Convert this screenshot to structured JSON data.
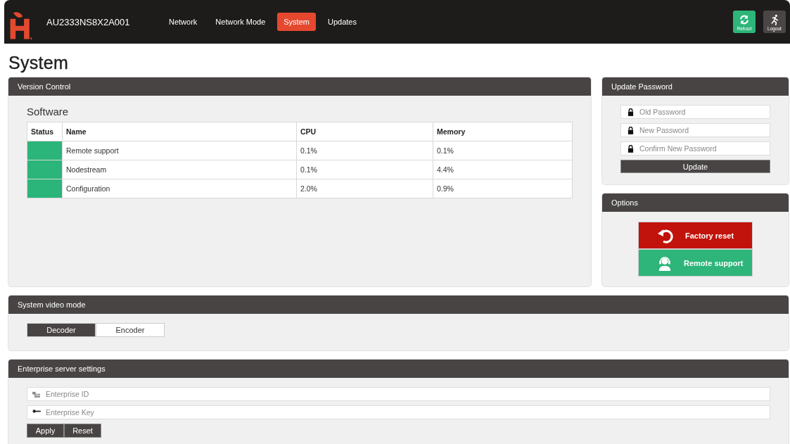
{
  "header": {
    "device_name": "AU2333NS8X2A001",
    "nav": [
      {
        "label": "Network",
        "selected": false
      },
      {
        "label": "Network Mode",
        "selected": false
      },
      {
        "label": "System",
        "selected": true
      },
      {
        "label": "Updates",
        "selected": false
      }
    ],
    "actions": [
      {
        "label": "Reboot",
        "kind": "reboot"
      },
      {
        "label": "Logout",
        "kind": "logout"
      }
    ]
  },
  "page_title": "System",
  "version_control": {
    "title": "Version Control",
    "heading": "Software",
    "columns": [
      "Status",
      "Name",
      "CPU",
      "Memory"
    ],
    "rows": [
      {
        "color": "#2bb57a",
        "name": "Remote support",
        "cpu": "0.1%",
        "memory": "0.1%"
      },
      {
        "color": "#2bb57a",
        "name": "Nodestream",
        "cpu": "0.1%",
        "memory": "4.4%"
      },
      {
        "color": "#2bb57a",
        "name": "Configuration",
        "cpu": "2.0%",
        "memory": "0.9%"
      }
    ]
  },
  "update_password": {
    "title": "Update Password",
    "fields": [
      {
        "placeholder": "Old Password"
      },
      {
        "placeholder": "New Password"
      },
      {
        "placeholder": "Confirm New Password"
      }
    ],
    "button": "Update"
  },
  "options": {
    "title": "Options",
    "buttons": [
      {
        "label": "Factory reset",
        "kind": "reset"
      },
      {
        "label": "Remote support",
        "kind": "support"
      }
    ]
  },
  "video_mode": {
    "title": "System video mode",
    "modes": [
      {
        "label": "Decoder",
        "selected": true
      },
      {
        "label": "Encoder",
        "selected": false
      }
    ]
  },
  "enterprise": {
    "title": "Enterprise server settings",
    "fields": [
      {
        "placeholder": "Enterprise ID",
        "kind": "id"
      },
      {
        "placeholder": "Enterprise Key",
        "kind": "key"
      }
    ],
    "buttons": [
      "Apply",
      "Reset"
    ]
  }
}
